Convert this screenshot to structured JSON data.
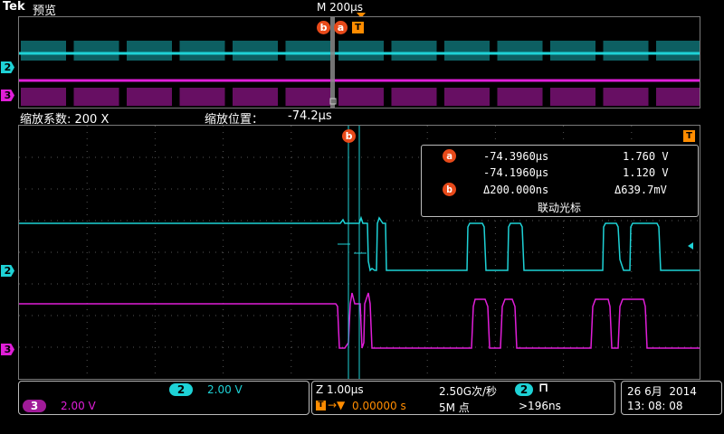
{
  "header": {
    "brand": "Tek",
    "mode": "预览",
    "timebase": "M 200µs"
  },
  "zoom": {
    "factor_label": "缩放系数: 200 X",
    "position_label": "缩放位置：",
    "position_value": "-74.2µs"
  },
  "markers": {
    "cursor_a": "a",
    "cursor_b": "b",
    "trigger": "T"
  },
  "channels": [
    {
      "id": "2",
      "color": "#1ed2d6",
      "scale": "2.00 V"
    },
    {
      "id": "3",
      "color": "#e01ed8",
      "scale": "2.00 V"
    }
  ],
  "cursor_readout": {
    "a_time": "-74.3960µs",
    "a_volt": "1.760 V",
    "b_time": "-74.1960µs",
    "b_volt": "1.120 V",
    "delta_time": "Δ200.000ns",
    "delta_volt": "Δ639.7mV",
    "mode_label": "联动光标"
  },
  "status": {
    "zoom_scale": "Z 1.00µs",
    "trigger_pos": "0.00000 s",
    "sample_rate": "2.50G次/秒",
    "record_length": "5M 点",
    "trigger_channel": "2",
    "trigger_value": ">196ns",
    "date": "26 6月  2014",
    "time": "13: 08: 08"
  }
}
